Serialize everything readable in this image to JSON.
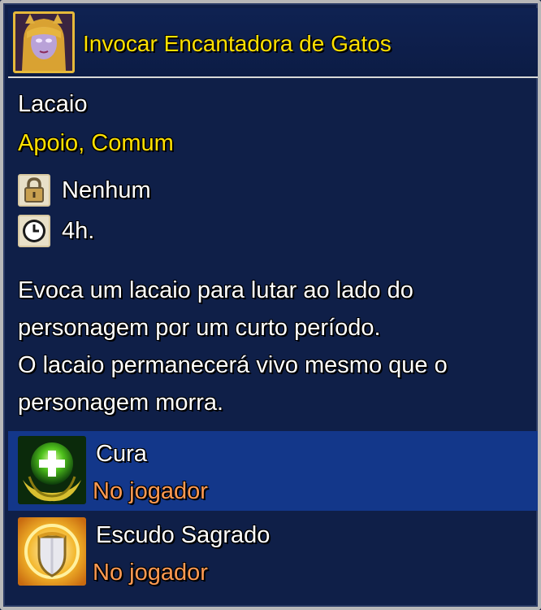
{
  "skill": {
    "icon": "cat-enchantress-portrait-icon",
    "title": "Invocar Encantadora de Gatos",
    "type": "Lacaio",
    "tags": "Apoio, Comum",
    "requirement_icon": "lock-icon",
    "requirement": "Nenhum",
    "cooldown_icon": "clock-icon",
    "cooldown": "4h.",
    "description": [
      "Evoca um lacaio para lutar ao lado do",
      "personagem por um curto período.",
      "O lacaio permanecerá vivo mesmo que o",
      "personagem morra."
    ]
  },
  "effects": [
    {
      "icon": "healing-hands-icon",
      "name": "Cura",
      "target": "No jogador",
      "selected": true
    },
    {
      "icon": "holy-shield-icon",
      "name": "Escudo Sagrado",
      "target": "No jogador",
      "selected": false
    }
  ],
  "colors": {
    "title": "#ffe100",
    "tags": "#ffe100",
    "target": "#ff9a52",
    "selected_row": "#13378a",
    "background": "#0f1f48"
  }
}
